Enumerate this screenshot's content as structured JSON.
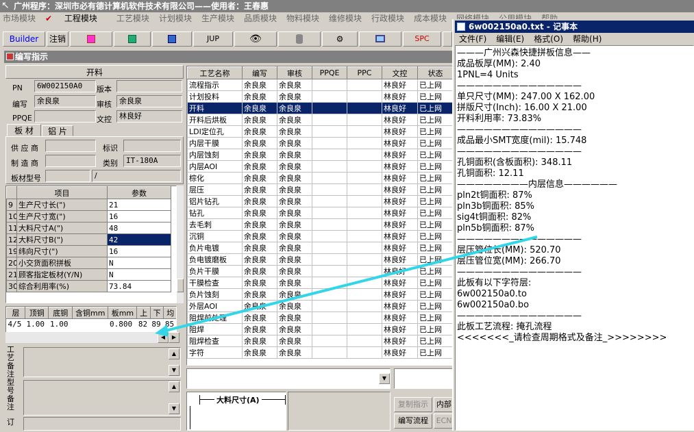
{
  "app_title": "广州程序：深圳市必有德计算机软件技术有限公司——使用者：王春惠",
  "menu": [
    "市场模块",
    "工程模块",
    "工艺模块",
    "计划模块",
    "生产模块",
    "品质模块",
    "物料模块",
    "维修模块",
    "行政模块",
    "成本模块",
    "网络模块",
    "公用模块",
    "帮助"
  ],
  "toolbar": {
    "builder": "Builder",
    "logout": "注销",
    "jup": "JUP",
    "spc": "SPC"
  },
  "child_title": "编写指示",
  "form": {
    "section": "开料",
    "pn_label": "PN",
    "pn_value": "6W002150A0",
    "version_label": "版本",
    "version_value": "",
    "author_label": "编写",
    "author_value": "余良泉",
    "review_label": "审核",
    "review_value": "余良泉",
    "ppqe_label": "PPQE",
    "ppqe_value": "",
    "doc_label": "文控",
    "doc_value": "林良好",
    "tabs": [
      "板 材",
      "铝 片"
    ],
    "supplier_label": "供 应 商",
    "mark_label": "标识",
    "maker_label": "制 造 商",
    "category_label": "类别",
    "category_value": "IT-180A",
    "model_label": "板材型号",
    "model_value": "/"
  },
  "params": {
    "headers": [
      "项目",
      "参数"
    ],
    "rows": [
      {
        "n": "9",
        "name": "生产尺寸长(\")",
        "val": "21"
      },
      {
        "n": "10",
        "name": "生产尺寸宽(\")",
        "val": "16"
      },
      {
        "n": "11",
        "name": "大料尺寸A(\")",
        "val": "48"
      },
      {
        "n": "12",
        "name": "大料尺寸B(\")",
        "val": "42"
      },
      {
        "n": "19",
        "name": "纬向尺寸(\")",
        "val": "16"
      },
      {
        "n": "20",
        "name": "小交货面积拼板",
        "val": "N"
      },
      {
        "n": "21",
        "name": "顾客指定板材(Y/N)",
        "val": "N"
      },
      {
        "n": "30",
        "name": "综合利用率(%)",
        "val": "73.84"
      }
    ]
  },
  "layers": {
    "headers": [
      "层",
      "顶铜",
      "底铜",
      "含铜mm",
      "板mm",
      "上",
      "下",
      "均"
    ],
    "row": [
      "4/5",
      "1.00",
      "1.00",
      "",
      "0.800",
      "82",
      "89",
      "85"
    ]
  },
  "side_labels": {
    "process_note": "工艺备注",
    "model_note": "型号备注",
    "order_note": "订"
  },
  "process": {
    "headers": [
      "工艺名称",
      "编写",
      "审核",
      "PPQE",
      "PPC",
      "文控",
      "状态"
    ],
    "rows": [
      [
        "流程指示",
        "余良泉",
        "余良泉",
        "",
        "",
        "林良好",
        "已上网"
      ],
      [
        "计划投料",
        "余良泉",
        "余良泉",
        "",
        "",
        "林良好",
        "已上网"
      ],
      [
        "开料",
        "余良泉",
        "余良泉",
        "",
        "",
        "林良好",
        "已上网"
      ],
      [
        "开料后烘板",
        "余良泉",
        "余良泉",
        "",
        "",
        "林良好",
        "已上网"
      ],
      [
        "LDI定位孔",
        "余良泉",
        "余良泉",
        "",
        "",
        "林良好",
        "已上网"
      ],
      [
        "内层干膜",
        "余良泉",
        "余良泉",
        "",
        "",
        "林良好",
        "已上网"
      ],
      [
        "内层蚀刻",
        "余良泉",
        "余良泉",
        "",
        "",
        "林良好",
        "已上网"
      ],
      [
        "内层AOI",
        "余良泉",
        "余良泉",
        "",
        "",
        "林良好",
        "已上网"
      ],
      [
        "棕化",
        "余良泉",
        "余良泉",
        "",
        "",
        "林良好",
        "已上网"
      ],
      [
        "层压",
        "余良泉",
        "余良泉",
        "",
        "",
        "林良好",
        "已上网"
      ],
      [
        "铝片钻孔",
        "余良泉",
        "余良泉",
        "",
        "",
        "林良好",
        "已上网"
      ],
      [
        "钻孔",
        "余良泉",
        "余良泉",
        "",
        "",
        "林良好",
        "已上网"
      ],
      [
        "去毛刺",
        "余良泉",
        "余良泉",
        "",
        "",
        "林良好",
        "已上网"
      ],
      [
        "沉铜",
        "余良泉",
        "余良泉",
        "",
        "",
        "林良好",
        "已上网"
      ],
      [
        "负片电镀",
        "余良泉",
        "余良泉",
        "",
        "",
        "林良好",
        "已上网"
      ],
      [
        "负电镀磨板",
        "余良泉",
        "余良泉",
        "",
        "",
        "林良好",
        "已上网"
      ],
      [
        "负片干膜",
        "余良泉",
        "余良泉",
        "",
        "",
        "林良好",
        "已上网"
      ],
      [
        "干膜检查",
        "余良泉",
        "余良泉",
        "",
        "",
        "林良好",
        "已上网"
      ],
      [
        "负片蚀刻",
        "余良泉",
        "余良泉",
        "",
        "",
        "林良好",
        "已上网"
      ],
      [
        "外层AOI",
        "余良泉",
        "余良泉",
        "",
        "",
        "林良好",
        "已上网"
      ],
      [
        "阻焊前处理",
        "余良泉",
        "余良泉",
        "",
        "",
        "林良好",
        "已上网"
      ],
      [
        "阻焊",
        "余良泉",
        "余良泉",
        "",
        "",
        "林良好",
        "已上网"
      ],
      [
        "阻焊检查",
        "余良泉",
        "余良泉",
        "",
        "",
        "林良好",
        "已上网"
      ],
      [
        "字符",
        "余良泉",
        "余良泉",
        "",
        "",
        "林良好",
        "已上网"
      ]
    ],
    "selected": 2
  },
  "bottom": {
    "dim_label": "大料尺寸(A)",
    "copy_btn": "复制指示",
    "write_btn": "编写流程",
    "inner_btn": "内部",
    "ecn_btn": "ECN"
  },
  "notepad": {
    "title": "6w002150a0.txt - 记事本",
    "menu": [
      "文件(F)",
      "编辑(E)",
      "格式(O)",
      "帮助(H)"
    ],
    "lines": [
      "———广州兴森快捷拼板信息——",
      "成品板厚(MM): 2.40",
      "1PNL=4 Units",
      "——————————————",
      "单只尺寸(MM): 247.00 X 162.00",
      "拼版尺寸(Inch): 16.00 X 21.00",
      "开料利用率: 73.83%",
      "——————————————",
      "成品最小SMT宽度(mil): 15.748",
      "——————————————",
      "孔铜面积(含板面积): 348.11",
      "孔铜面积: 12.11",
      "————————内层信息——————",
      "pln2t铜面积: 87%",
      "pln3b铜面积: 85%",
      "sig4t铜面积: 82%",
      "pln5b铜面积: 87%",
      "——————————————",
      "层压管位长(MM): 520.70",
      "层压管位宽(MM): 266.70",
      "——————————————",
      "此板有以下字符层:",
      "6w002150a0.to",
      "6w002150a0.bo",
      "——————————————",
      "此板工艺流程: 掩孔流程",
      "<<<<<<<_请检查周期格式及备注_>>>>>>>>"
    ]
  },
  "colors": {
    "arrow": "#33d6e8",
    "selection": "#0a246a",
    "titlebar": "#0a246a"
  }
}
